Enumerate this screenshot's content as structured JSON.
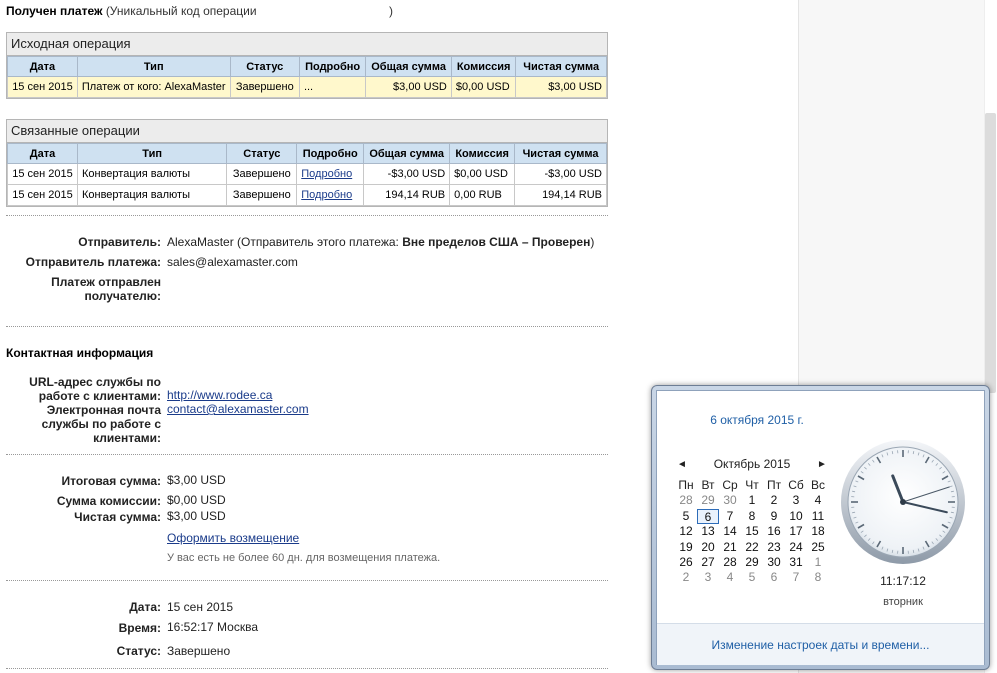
{
  "header": {
    "title_bold": "Получен платеж",
    "title_rest": "(Уникальный код операции",
    "close_paren": ")"
  },
  "original_op": {
    "title": "Исходная операция",
    "columns": [
      "Дата",
      "Тип",
      "Статус",
      "Подробно",
      "Общая сумма",
      "Комиссия",
      "Чистая сумма"
    ],
    "rows": [
      {
        "date": "15 сен 2015",
        "type": "Платеж от кого: AlexaMaster",
        "status": "Завершено",
        "details": "...",
        "total": "$3,00 USD",
        "fee": "$0,00 USD",
        "net": "$3,00 USD"
      }
    ]
  },
  "related_ops": {
    "title": "Связанные операции",
    "columns": [
      "Дата",
      "Тип",
      "Статус",
      "Подробно",
      "Общая сумма",
      "Комиссия",
      "Чистая сумма"
    ],
    "rows": [
      {
        "date": "15 сен 2015",
        "type": "Конвертация валюты",
        "status": "Завершено",
        "details": "Подробно",
        "total": "-$3,00 USD",
        "fee": "$0,00 USD",
        "net": "-$3,00 USD"
      },
      {
        "date": "15 сен 2015",
        "type": "Конвертация валюты",
        "status": "Завершено",
        "details": "Подробно",
        "total": "194,14 RUB",
        "fee": "0,00 RUB",
        "net": "194,14 RUB"
      }
    ]
  },
  "sender": {
    "sender_label": "Отправитель:",
    "sender_value_plain": "AlexaMaster (Отправитель этого платежа: ",
    "sender_value_bold": "Вне пределов США – Проверен",
    "sender_value_end": ")",
    "payer_label": "Отправитель платежа:",
    "payer_value": "sales@alexamaster.com",
    "sent_to_label_1": "Платеж отправлен",
    "sent_to_label_2": "получателю:"
  },
  "contact": {
    "heading": "Контактная информация",
    "url_label_1": "URL-адрес службы по",
    "url_label_2": "работе с клиентами:",
    "url_value": "http://www.rodee.ca",
    "email_label_1": "Электронная почта",
    "email_label_2": "службы по работе с",
    "email_label_3": "клиентами:",
    "email_value": "contact@alexamaster.com"
  },
  "amounts": {
    "total_label": "Итоговая сумма:",
    "total_value": "$3,00 USD",
    "fee_label": "Сумма комиссии:",
    "fee_value": "$0,00 USD",
    "net_label": "Чистая сумма:",
    "net_value": "$3,00 USD",
    "refund_link": "Оформить возмещение",
    "refund_note": "У вас есть не более 60 дн. для возмещения платежа."
  },
  "details": {
    "date_label": "Дата:",
    "date_value": "15 сен 2015",
    "time_label": "Время:",
    "time_value": "16:52:17 Москва",
    "status_label": "Статус:",
    "status_value": "Завершено"
  },
  "calendar": {
    "full_date": "6 октября 2015 г.",
    "month": "Октябрь 2015",
    "prev_icon": "◄",
    "next_icon": "►",
    "weekdays": [
      "Пн",
      "Вт",
      "Ср",
      "Чт",
      "Пт",
      "Сб",
      "Вс"
    ],
    "weeks": [
      [
        {
          "d": "28",
          "dim": true
        },
        {
          "d": "29",
          "dim": true
        },
        {
          "d": "30",
          "dim": true
        },
        {
          "d": "1"
        },
        {
          "d": "2"
        },
        {
          "d": "3"
        },
        {
          "d": "4"
        }
      ],
      [
        {
          "d": "5"
        },
        {
          "d": "6",
          "today": true
        },
        {
          "d": "7"
        },
        {
          "d": "8"
        },
        {
          "d": "9"
        },
        {
          "d": "10"
        },
        {
          "d": "11"
        }
      ],
      [
        {
          "d": "12"
        },
        {
          "d": "13"
        },
        {
          "d": "14"
        },
        {
          "d": "15"
        },
        {
          "d": "16"
        },
        {
          "d": "17"
        },
        {
          "d": "18"
        }
      ],
      [
        {
          "d": "19"
        },
        {
          "d": "20"
        },
        {
          "d": "21"
        },
        {
          "d": "22"
        },
        {
          "d": "23"
        },
        {
          "d": "24"
        },
        {
          "d": "25"
        }
      ],
      [
        {
          "d": "26"
        },
        {
          "d": "27"
        },
        {
          "d": "28"
        },
        {
          "d": "29"
        },
        {
          "d": "30"
        },
        {
          "d": "31"
        },
        {
          "d": "1",
          "dim": true
        }
      ],
      [
        {
          "d": "2",
          "dim": true
        },
        {
          "d": "3",
          "dim": true
        },
        {
          "d": "4",
          "dim": true
        },
        {
          "d": "5",
          "dim": true
        },
        {
          "d": "6",
          "dim": true
        },
        {
          "d": "7",
          "dim": true
        },
        {
          "d": "8",
          "dim": true
        }
      ]
    ],
    "time": "11:17:12",
    "weekday": "вторник",
    "clock": {
      "hours": 11,
      "minutes": 17,
      "seconds": 12
    },
    "settings_link": "Изменение настроек даты и времени..."
  },
  "colors": {
    "link": "#1a3b8a",
    "popup_link": "#1f5fa6",
    "table_header": "#cfe1f1",
    "highlight_row": "#fff8cc"
  }
}
